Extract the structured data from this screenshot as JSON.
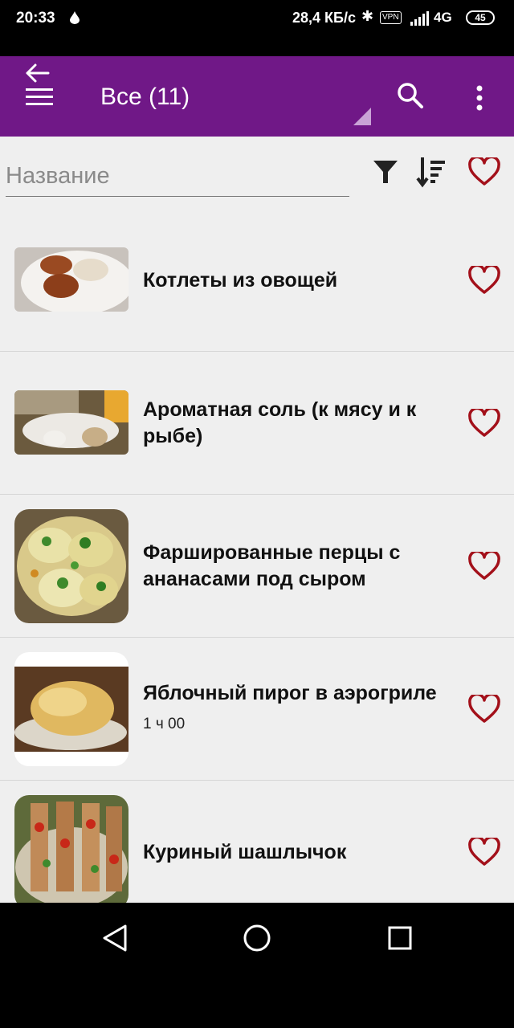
{
  "status_bar": {
    "time": "20:33",
    "speed": "28,4 КБ/с",
    "vpn": "VPN",
    "network": "4G",
    "battery": "45"
  },
  "app_bar": {
    "title": "Все (11)",
    "back_icon": "arrow-left-icon",
    "menu_icon": "hamburger-icon",
    "search_icon": "search-icon",
    "more_icon": "more-vertical-icon"
  },
  "search": {
    "placeholder": "Название",
    "value": ""
  },
  "recipes": [
    {
      "title": "Котлеты из овощей",
      "subtitle": ""
    },
    {
      "title": "Ароматная соль (к мясу и к рыбе)",
      "subtitle": ""
    },
    {
      "title": "Фаршированные перцы с ананасами под сыром",
      "subtitle": ""
    },
    {
      "title": "Яблочный пирог в аэрогриле",
      "subtitle": "1 ч 00"
    },
    {
      "title": "Куриный шашлычок",
      "subtitle": ""
    }
  ],
  "colors": {
    "app_bar": "#701887",
    "heart": "#a3101a",
    "background": "#efefef"
  }
}
